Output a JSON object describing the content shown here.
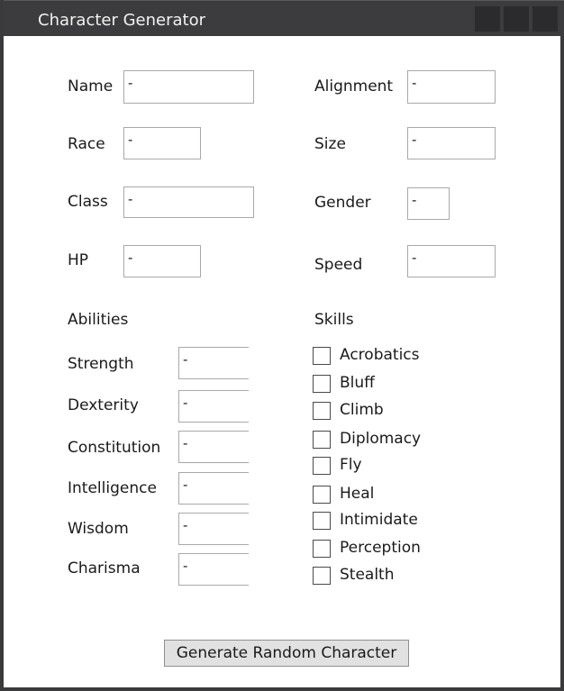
{
  "window": {
    "title": "Character Generator"
  },
  "fields": {
    "name": {
      "label": "Name",
      "value": "-"
    },
    "race": {
      "label": "Race",
      "value": "-"
    },
    "class": {
      "label": "Class",
      "value": "-"
    },
    "hp": {
      "label": "HP",
      "value": "-"
    },
    "alignment": {
      "label": "Alignment",
      "value": "-"
    },
    "size": {
      "label": "Size",
      "value": "-"
    },
    "gender": {
      "label": "Gender",
      "value": "-"
    },
    "speed": {
      "label": "Speed",
      "value": "-"
    }
  },
  "abilities": {
    "heading": "Abilities",
    "items": [
      {
        "label": "Strength",
        "value": "-"
      },
      {
        "label": "Dexterity",
        "value": "-"
      },
      {
        "label": "Constitution",
        "value": "-"
      },
      {
        "label": "Intelligence",
        "value": "-"
      },
      {
        "label": "Wisdom",
        "value": "-"
      },
      {
        "label": "Charisma",
        "value": "-"
      }
    ]
  },
  "skills": {
    "heading": "Skills",
    "items": [
      {
        "label": "Acrobatics",
        "checked": false
      },
      {
        "label": "Bluff",
        "checked": false
      },
      {
        "label": "Climb",
        "checked": false
      },
      {
        "label": "Diplomacy",
        "checked": false
      },
      {
        "label": "Fly",
        "checked": false
      },
      {
        "label": "Heal",
        "checked": false
      },
      {
        "label": "Intimidate",
        "checked": false
      },
      {
        "label": "Perception",
        "checked": false
      },
      {
        "label": "Stealth",
        "checked": false
      }
    ]
  },
  "generate_button": {
    "label": "Generate Random Character"
  }
}
